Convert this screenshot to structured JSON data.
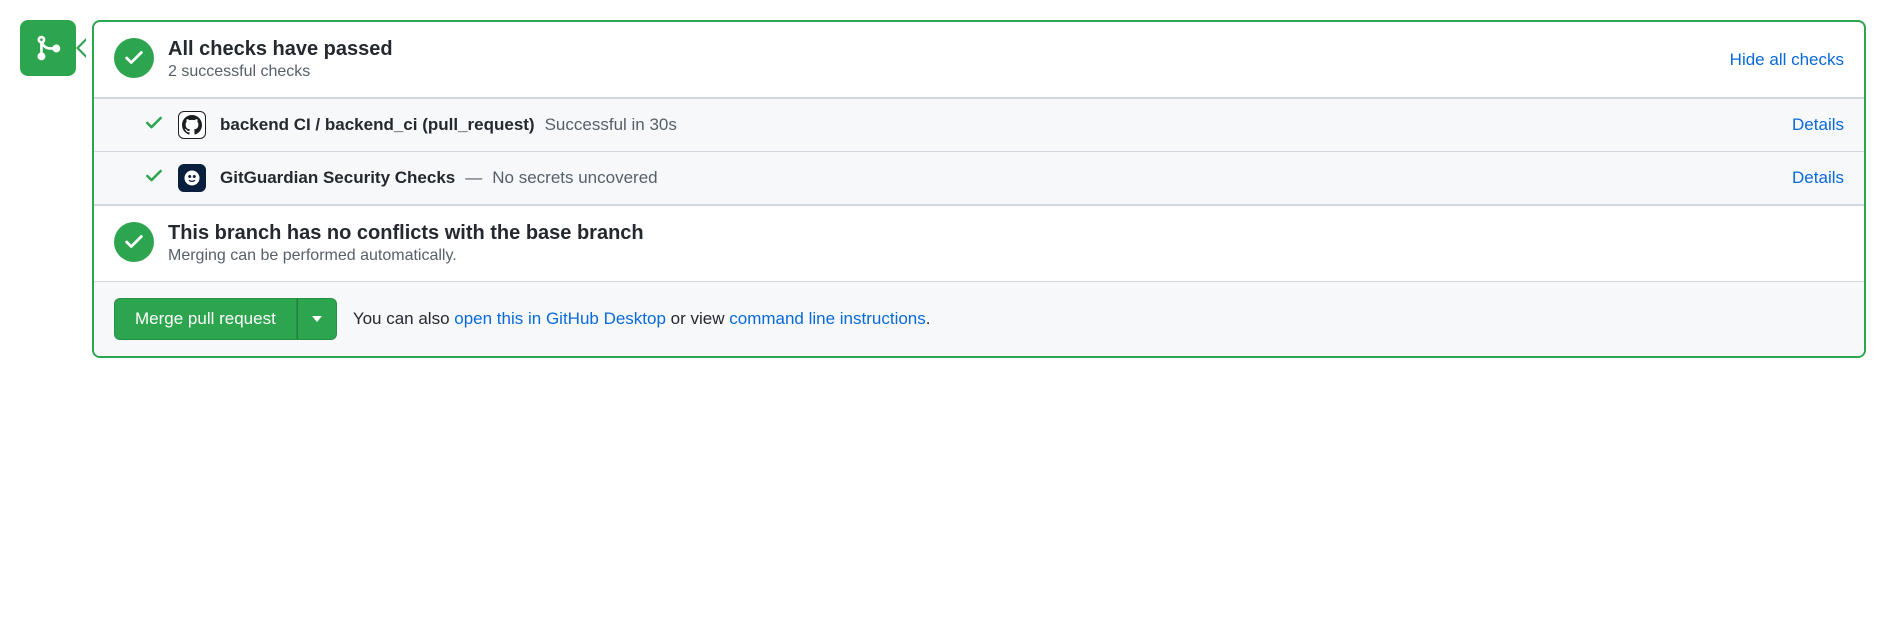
{
  "checks_header": {
    "title": "All checks have passed",
    "subtitle": "2 successful checks",
    "hide_link": "Hide all checks"
  },
  "checks": [
    {
      "icon": "github",
      "name": "backend CI / backend_ci (pull_request)",
      "status": "Successful in 30s",
      "separator": "",
      "details": "Details"
    },
    {
      "icon": "gitguardian",
      "name": "GitGuardian Security Checks",
      "separator": "—",
      "status": "No secrets uncovered",
      "details": "Details"
    }
  ],
  "conflicts": {
    "title": "This branch has no conflicts with the base branch",
    "subtitle": "Merging can be performed automatically."
  },
  "footer": {
    "merge_label": "Merge pull request",
    "prefix": "You can also ",
    "desktop_link": "open this in GitHub Desktop",
    "middle": " or view ",
    "cli_link": "command line instructions",
    "suffix": "."
  }
}
